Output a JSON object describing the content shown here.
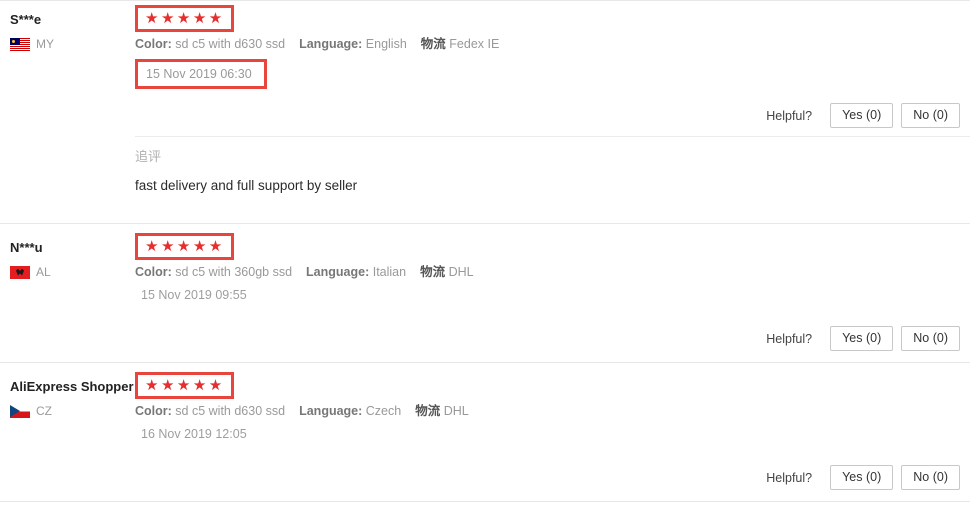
{
  "meta_labels": {
    "color": "Color:",
    "language": "Language:",
    "logistics": "物流",
    "helpful": "Helpful?",
    "followup": "追评"
  },
  "colors": {
    "star": "#e62e2e",
    "annotation_box": "#e8453c",
    "divider": "#e8e8e8",
    "meta_text": "#999999"
  },
  "reviews": [
    {
      "user": "S***e",
      "country_code": "MY",
      "flag": "flag-malaysia-icon",
      "stars": "★★★★★",
      "rating": 5,
      "color": "sd c5 with d630 ssd",
      "language": "English",
      "logistics": "Fedex IE",
      "date": "15 Nov 2019 06:30",
      "date_highlighted": true,
      "helpful_label": "Helpful?",
      "yes_label": "Yes (0)",
      "no_label": "No (0)",
      "followup_label": "追评",
      "followup_text": "fast delivery and full support by seller"
    },
    {
      "user": "N***u",
      "country_code": "AL",
      "flag": "flag-albania-icon",
      "stars": "★★★★★",
      "rating": 5,
      "color": "sd c5 with 360gb ssd",
      "language": "Italian",
      "logistics": "DHL",
      "date": "15 Nov 2019 09:55",
      "date_highlighted": false,
      "helpful_label": "Helpful?",
      "yes_label": "Yes (0)",
      "no_label": "No (0)"
    },
    {
      "user": "AliExpress Shopper",
      "country_code": "CZ",
      "flag": "flag-czech-icon",
      "stars": "★★★★★",
      "rating": 5,
      "color": "sd c5 with d630 ssd",
      "language": "Czech",
      "logistics": "DHL",
      "date": "16 Nov 2019 12:05",
      "date_highlighted": false,
      "helpful_label": "Helpful?",
      "yes_label": "Yes (0)",
      "no_label": "No (0)"
    }
  ]
}
